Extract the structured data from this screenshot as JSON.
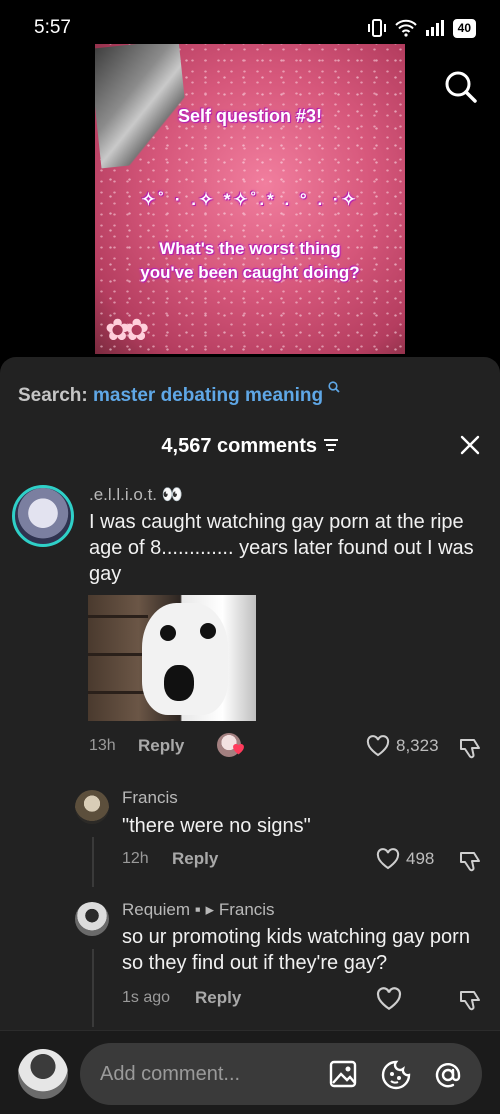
{
  "status": {
    "time": "5:57",
    "battery": "40"
  },
  "video": {
    "line1": "Self question #3!",
    "line2": "✧˚ · .✧ *✧˚.* . ° . ·✧",
    "line3a": "What's the worst thing",
    "line3b": "you've been caught doing?",
    "flowers": "✿✿"
  },
  "search": {
    "label": "Search:",
    "query": "master debating meaning"
  },
  "comments_header": {
    "count_label": "4,567 comments"
  },
  "comments": [
    {
      "author": ".e.l.l.i.o.t. 👀",
      "text": "I was caught watching gay porn at the ripe age of 8............. years later found out I was gay",
      "time": "13h",
      "reply_label": "Reply",
      "likes": "8,323"
    }
  ],
  "replies": [
    {
      "author": "Francis",
      "text": "\"there were no signs\"",
      "time": "12h",
      "reply_label": "Reply",
      "likes": "498"
    },
    {
      "author": "Requiem",
      "badge": "▪ ▸",
      "reply_to": "Francis",
      "text": "so ur promoting kids watching gay porn so they find out if they're gay?",
      "time": "1s ago",
      "reply_label": "Reply",
      "likes": ""
    }
  ],
  "composer": {
    "placeholder": "Add comment..."
  },
  "colors": {
    "panel": "#222222",
    "link": "#5fa7e6",
    "accent_ring": "#2fd0c8"
  }
}
